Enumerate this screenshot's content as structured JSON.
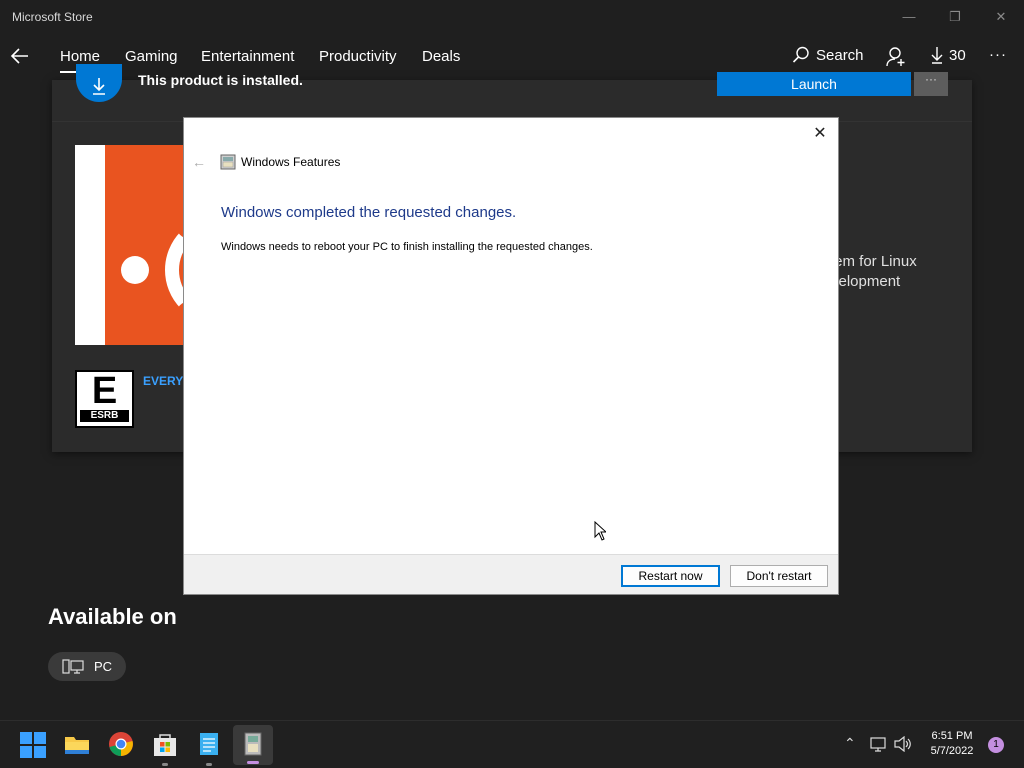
{
  "window": {
    "title": "Microsoft Store",
    "minimize": "—",
    "maximize": "❐",
    "close": "✕"
  },
  "nav": {
    "items": [
      "Home",
      "Gaming",
      "Entertainment",
      "Productivity",
      "Deals"
    ],
    "search_label": "Search",
    "downloads_count": "30",
    "more": "···"
  },
  "product": {
    "installed_text": "This product is installed.",
    "launch_label": "Launch",
    "more_label": "···",
    "rating_label": "EVERYO",
    "esrb_letter": "E",
    "esrb_brand": "ESRB",
    "desc_line1": "tem for Linux",
    "desc_line2": "velopment",
    "tile_color": "#e95420"
  },
  "available": {
    "heading": "Available on",
    "platform": "PC"
  },
  "dialog": {
    "close": "✕",
    "back": "←",
    "app_title": "Windows Features",
    "heading": "Windows completed the requested changes.",
    "body": "Windows needs to reboot your PC to finish installing the requested changes.",
    "restart_label": "Restart now",
    "dont_restart_label": "Don't restart"
  },
  "taskbar": {
    "time": "6:51 PM",
    "date": "5/7/2022",
    "notifications": "1",
    "apps": [
      "start-icon",
      "file-explorer-icon",
      "chrome-icon",
      "store-icon",
      "notepad-icon",
      "windows-features-icon"
    ]
  },
  "colors": {
    "accent": "#0078d4",
    "background": "#1f1f1f",
    "card": "#2b2b2b"
  }
}
